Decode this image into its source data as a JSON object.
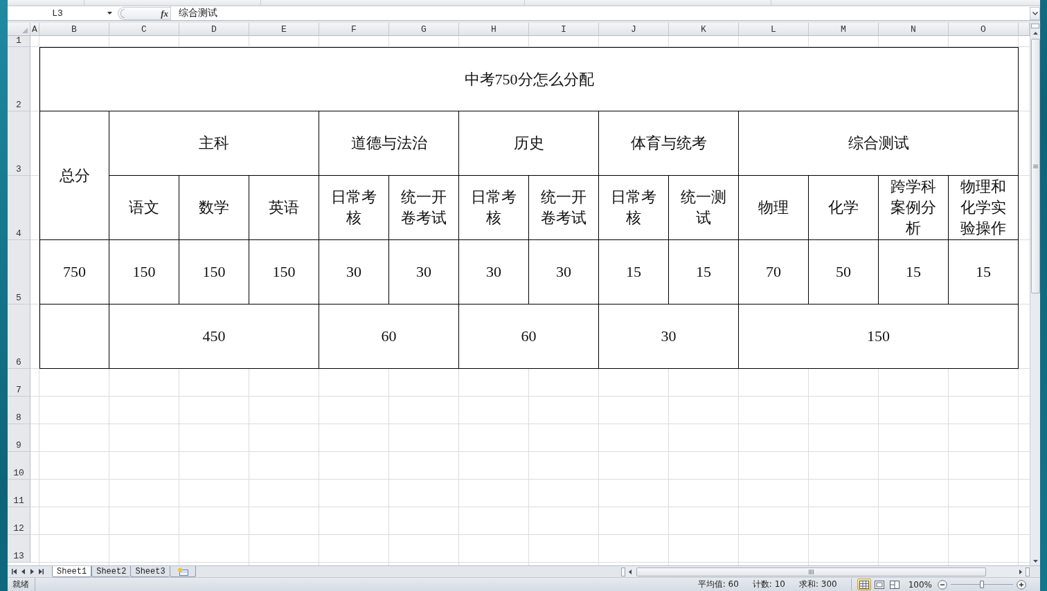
{
  "formula_bar": {
    "name_box": "L3",
    "function_label": "fx",
    "formula": "综合测试"
  },
  "columns": [
    "A",
    "B",
    "C",
    "D",
    "E",
    "F",
    "G",
    "H",
    "I",
    "J",
    "K",
    "L",
    "M",
    "N",
    "O"
  ],
  "rows": [
    "1",
    "2",
    "3",
    "4",
    "5",
    "6",
    "7",
    "8",
    "9",
    "10",
    "11",
    "12",
    "13"
  ],
  "table": {
    "title": "中考750分怎么分配",
    "total_label": "总分",
    "total": "750",
    "groups": [
      {
        "label": "主科",
        "subtotal": "450",
        "subjects": [
          {
            "label": "语文",
            "score": "150"
          },
          {
            "label": "数学",
            "score": "150"
          },
          {
            "label": "英语",
            "score": "150"
          }
        ]
      },
      {
        "label": "道德与法治",
        "subtotal": "60",
        "subjects": [
          {
            "label": "日常考核",
            "score": "30"
          },
          {
            "label": "统一开卷考试",
            "score": "30"
          }
        ]
      },
      {
        "label": "历史",
        "subtotal": "60",
        "subjects": [
          {
            "label": "日常考核",
            "score": "30"
          },
          {
            "label": "统一开卷考试",
            "score": "30"
          }
        ]
      },
      {
        "label": "体育与统考",
        "subtotal": "30",
        "subjects": [
          {
            "label": "日常考核",
            "score": "15"
          },
          {
            "label": "统一测试",
            "score": "15"
          }
        ]
      },
      {
        "label": "综合测试",
        "subtotal": "150",
        "subjects": [
          {
            "label": "物理",
            "score": "70"
          },
          {
            "label": "化学",
            "score": "50"
          },
          {
            "label": "跨学科案例分析",
            "score": "15"
          },
          {
            "label": "物理和化学实验操作",
            "score": "15"
          }
        ]
      }
    ]
  },
  "sheet_tabs": [
    {
      "label": "Sheet1",
      "selected": true
    },
    {
      "label": "Sheet2",
      "selected": false
    },
    {
      "label": "Sheet3",
      "selected": false
    }
  ],
  "status_bar": {
    "mode": "就绪",
    "average": "平均值: 60",
    "count": "计数: 10",
    "sum": "求和: 300",
    "views": [
      {
        "kind": "normal",
        "selected": true
      },
      {
        "kind": "page-layout",
        "selected": false
      },
      {
        "kind": "page-break",
        "selected": false
      }
    ],
    "zoom": "100%",
    "zoom_slider": {
      "level": 0.5
    }
  }
}
